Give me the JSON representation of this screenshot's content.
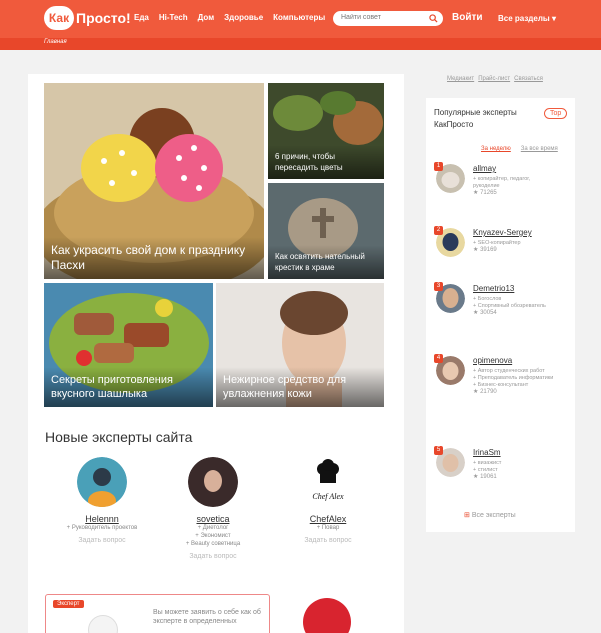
{
  "header": {
    "logo_bubble": "Как",
    "logo_text": "Просто!",
    "nav": [
      "Еда",
      "Hi-Tech",
      "Дом",
      "Здоровье",
      "Компьютеры"
    ],
    "search_placeholder": "Найти совет",
    "login": "Войти",
    "sections": "Все разделы ▾",
    "breadcrumb": "Главная"
  },
  "tiles": [
    {
      "caption": "Как украсить свой дом к празднику Пасхи"
    },
    {
      "caption": "6 причин, чтобы пересадить цветы"
    },
    {
      "caption": "Как освятить нательный крестик в храме"
    },
    {
      "caption": "Секреты приготовления вкусного шашлыка"
    },
    {
      "caption": "Нежирное средство для увлажнения кожи"
    }
  ],
  "new_experts": {
    "title": "Новые эксперты сайта",
    "ask": "Задать вопрос",
    "items": [
      {
        "name": "Helennn",
        "lines": [
          "+ Руководитель проектов"
        ]
      },
      {
        "name": "sovetica",
        "lines": [
          "+ Диетолог",
          "+ Экономист",
          "+ Beauty советница"
        ]
      },
      {
        "name": "ChefAlex",
        "lines": [
          "+ Повар"
        ],
        "logo": "Chef Alex"
      }
    ]
  },
  "ad": {
    "badge": "Эксперт",
    "text": "Вы можете заявить о себе как об эксперте в определенных"
  },
  "top_links": [
    "Медиакит",
    "Прайс-лист",
    "Связаться"
  ],
  "sidebar": {
    "title": "Популярные эксперты КакПросто",
    "badge": "Top",
    "tabs": [
      "За неделю",
      "За все время"
    ],
    "experts": [
      {
        "rank": "1",
        "name": "allmay",
        "info": [
          "+ копирайтер, педагог, рукоделие"
        ],
        "score": "71265"
      },
      {
        "rank": "2",
        "name": "Knyazev-Sergey",
        "info": [
          "+ SEO-копирайтер"
        ],
        "score": "39169"
      },
      {
        "rank": "3",
        "name": "Demetrio13",
        "info": [
          "+ Богослов",
          "+ Спортивный обозреватель"
        ],
        "score": "30054"
      },
      {
        "rank": "4",
        "name": "opimenova",
        "info": [
          "+ Автор студенческих работ",
          "+ Преподаватель информатики",
          "+ Бизнес-консультант"
        ],
        "score": "21790"
      },
      {
        "rank": "5",
        "name": "IrinaSm",
        "info": [
          "+ визажист",
          "+ стилист"
        ],
        "score": "19061"
      }
    ],
    "all": "Все эксперты"
  },
  "colors": {
    "brand": "#f05a3c",
    "brand_dark": "#e8472a"
  }
}
